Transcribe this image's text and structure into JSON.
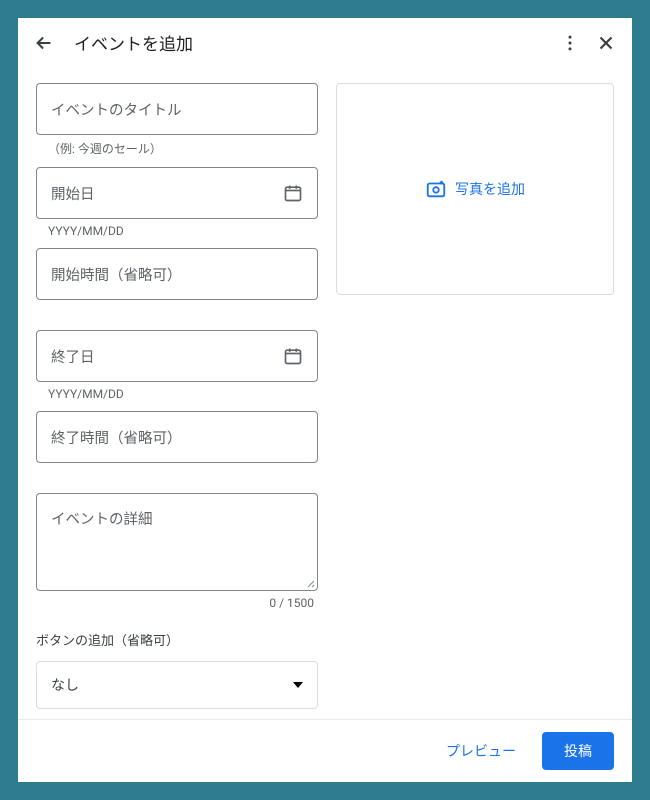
{
  "header": {
    "title": "イベントを追加"
  },
  "fields": {
    "title": {
      "placeholder": "イベントのタイトル",
      "helper": "（例: 今週のセール）"
    },
    "start_date": {
      "placeholder": "開始日",
      "helper": "YYYY/MM/DD"
    },
    "start_time": {
      "placeholder": "開始時間（省略可）"
    },
    "end_date": {
      "placeholder": "終了日",
      "helper": "YYYY/MM/DD"
    },
    "end_time": {
      "placeholder": "終了時間（省略可）"
    },
    "details": {
      "placeholder": "イベントの詳細",
      "count": "0 / 1500"
    },
    "button_section": {
      "label": "ボタンの追加（省略可）",
      "value": "なし"
    }
  },
  "photo": {
    "label": "写真を追加"
  },
  "footer": {
    "preview": "プレビュー",
    "submit": "投稿"
  }
}
